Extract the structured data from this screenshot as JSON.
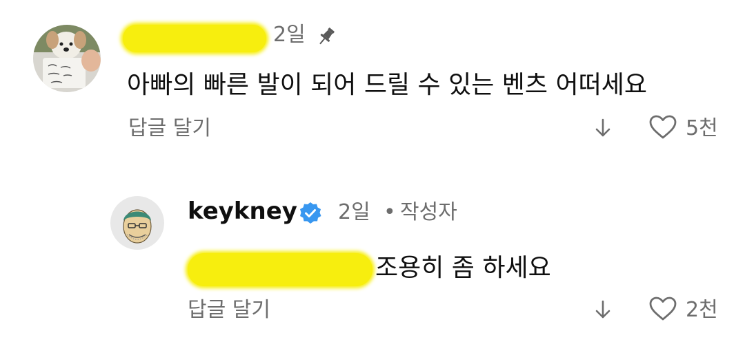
{
  "comment": {
    "time": "2일",
    "pinned": true,
    "text": "아빠의 빠른 발이 되어 드릴 수 있는 벤츠 어떠세요",
    "reply_label": "답글 달기",
    "likes": "5천",
    "redaction_color": "#f7ee0e"
  },
  "reply": {
    "author": "keykney",
    "verified": true,
    "time": "2일",
    "separator": "•",
    "creator_label": "작성자",
    "text": "조용히 좀 하세요",
    "reply_label": "답글 달기",
    "likes": "2천",
    "verified_color": "#3897f0"
  },
  "icons": {
    "pin": "pin-icon",
    "verified": "verified-badge-icon",
    "dislike": "arrow-down-icon",
    "like": "heart-outline-icon"
  }
}
